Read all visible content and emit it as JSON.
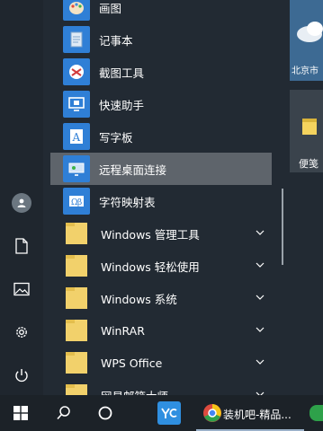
{
  "start_menu": {
    "apps": [
      {
        "label": "画图",
        "icon": "paint-icon"
      },
      {
        "label": "记事本",
        "icon": "notepad-icon"
      },
      {
        "label": "截图工具",
        "icon": "snipping-tool-icon"
      },
      {
        "label": "快速助手",
        "icon": "quick-assist-icon"
      },
      {
        "label": "写字板",
        "icon": "wordpad-icon"
      },
      {
        "label": "远程桌面连接",
        "icon": "remote-desktop-icon"
      },
      {
        "label": "字符映射表",
        "icon": "character-map-icon"
      }
    ],
    "folders": [
      {
        "label": "Windows 管理工具"
      },
      {
        "label": "Windows 轻松使用"
      },
      {
        "label": "Windows 系统"
      },
      {
        "label": "WinRAR"
      },
      {
        "label": "WPS Office"
      },
      {
        "label": "网易邮箱大师"
      }
    ]
  },
  "tiles": {
    "weather_city": "北京市",
    "notes_label": "便笺"
  },
  "taskbar": {
    "active_app_label": "装机吧-精品..."
  },
  "colors": {
    "highlight": "#5e646b",
    "folder": "#f2d16b",
    "accent_blue": "#2f7fd6"
  }
}
